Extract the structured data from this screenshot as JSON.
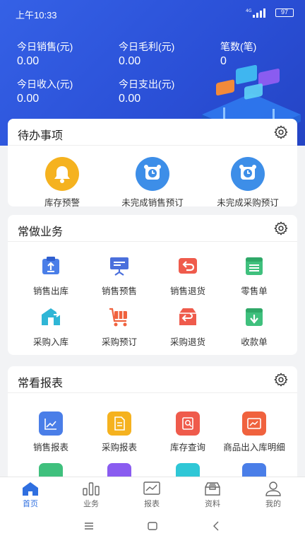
{
  "statusbar": {
    "time": "上午10:33",
    "signal": "4G",
    "battery": "97"
  },
  "summary": {
    "sales_label": "今日销售(元)",
    "sales_value": "0.00",
    "profit_label": "今日毛利(元)",
    "profit_value": "0.00",
    "count_label": "笔数(笔)",
    "count_value": "0",
    "income_label": "今日收入(元)",
    "income_value": "0.00",
    "expense_label": "今日支出(元)",
    "expense_value": "0.00"
  },
  "todo": {
    "title": "待办事项",
    "items": [
      {
        "label": "库存预警",
        "icon": "bell-icon",
        "color": "#f5b21f"
      },
      {
        "label": "未完成销售预订",
        "icon": "alarm-clock-icon",
        "color": "#3d8ee8"
      },
      {
        "label": "未完成采购预订",
        "icon": "alarm-clock-icon",
        "color": "#3d8ee8"
      }
    ]
  },
  "business": {
    "title": "常做业务",
    "items": [
      {
        "label": "销售出库",
        "icon": "outbound-icon",
        "color": "#4a7ee8"
      },
      {
        "label": "销售预售",
        "icon": "presale-board-icon",
        "color": "#4a6fdc"
      },
      {
        "label": "销售退货",
        "icon": "return-box-icon",
        "color": "#ef5b4c"
      },
      {
        "label": "零售单",
        "icon": "retail-list-icon",
        "color": "#3fc07d"
      },
      {
        "label": "采购入库",
        "icon": "warehouse-in-icon",
        "color": "#2fb6d6"
      },
      {
        "label": "采购预订",
        "icon": "cart-icon",
        "color": "#f0623e"
      },
      {
        "label": "采购退货",
        "icon": "purchase-return-icon",
        "color": "#ef5b4c"
      },
      {
        "label": "收款单",
        "icon": "receipt-icon",
        "color": "#3fc07d"
      }
    ]
  },
  "reports": {
    "title": "常看报表",
    "items": [
      {
        "label": "销售报表",
        "icon": "line-chart-icon",
        "color": "#4a7ee8"
      },
      {
        "label": "采购报表",
        "icon": "document-icon",
        "color": "#f5b21f"
      },
      {
        "label": "库存查询",
        "icon": "stock-search-icon",
        "color": "#ef5b4c"
      },
      {
        "label": "商品出入库明细",
        "icon": "inout-detail-icon",
        "color": "#f0623e"
      }
    ]
  },
  "tabs": [
    {
      "label": "首页",
      "icon": "home-icon"
    },
    {
      "label": "业务",
      "icon": "bar-chart-icon"
    },
    {
      "label": "报表",
      "icon": "report-icon"
    },
    {
      "label": "资料",
      "icon": "inbox-icon"
    },
    {
      "label": "我的",
      "icon": "user-icon"
    }
  ],
  "colors": {
    "primary": "#2f6fe0",
    "hero": "#2a4fd6"
  }
}
